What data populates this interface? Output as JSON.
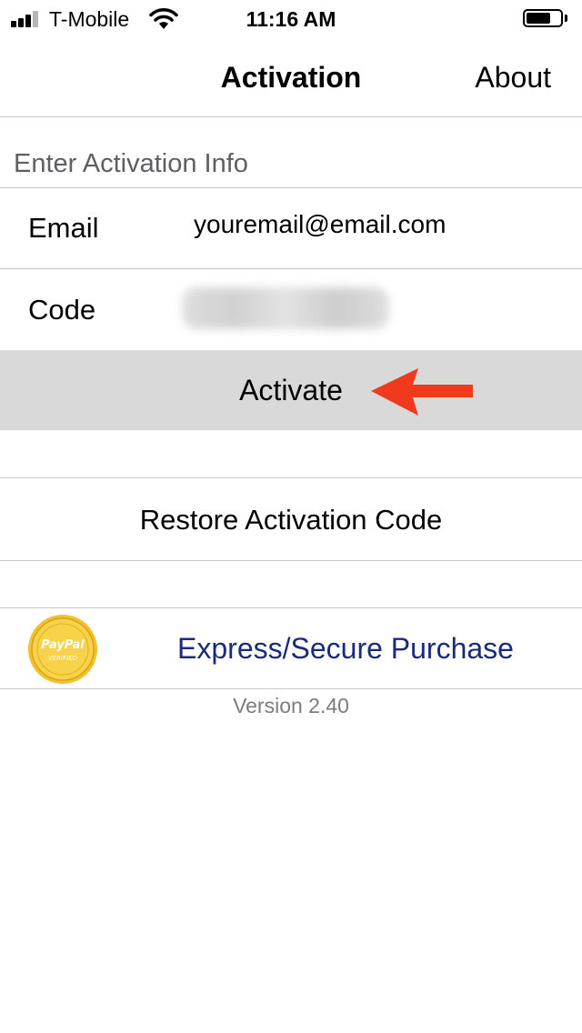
{
  "status_bar": {
    "carrier": "T-Mobile",
    "time": "11:16 AM",
    "battery_level": 0.8,
    "signal_bars": 3,
    "signal_total": 4
  },
  "nav": {
    "title": "Activation",
    "about_label": "About"
  },
  "section": {
    "header": "Enter Activation Info"
  },
  "form": {
    "email_label": "Email",
    "email_value": "youremail@email.com",
    "code_label": "Code"
  },
  "actions": {
    "activate_label": "Activate",
    "restore_label": "Restore Activation Code",
    "paypal_label": "Express/Secure Purchase"
  },
  "paypal_seal": {
    "line1": "PayPal",
    "line2": "VERIFIED"
  },
  "footer": {
    "version": "Version 2.40"
  },
  "colors": {
    "separator": "#c8c7cc",
    "highlight_row": "#d9d9d9",
    "link_blue": "#1a2a7c",
    "arrow_red": "#f03a1e",
    "seal_gold": "#f2c12e"
  },
  "icons": {
    "signal": "cellular-signal-icon",
    "wifi": "wifi-icon",
    "battery": "battery-icon",
    "arrow": "red-left-arrow-icon",
    "paypal": "paypal-verified-seal-icon"
  }
}
